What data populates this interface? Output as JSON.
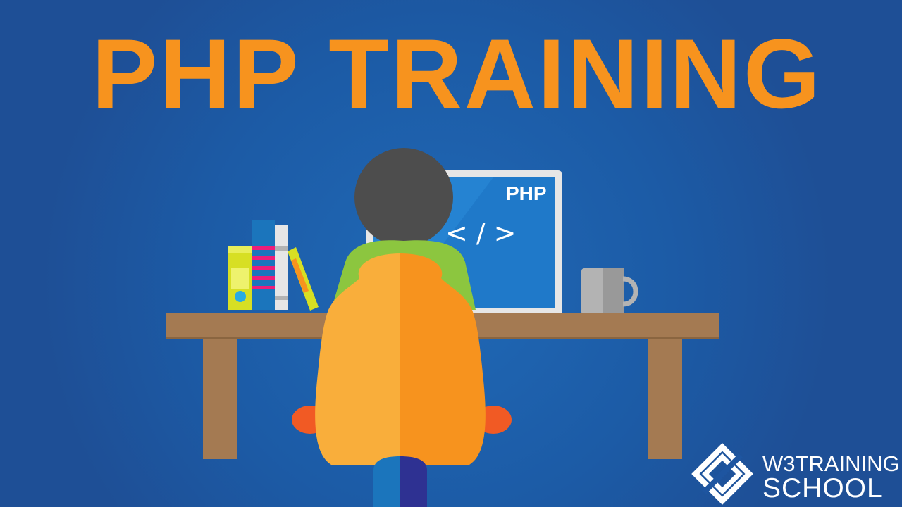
{
  "title": "PHP TRAINING",
  "laptop": {
    "screen_label": "PHP",
    "code_symbol": "</>"
  },
  "brand": {
    "line1": "W3TRAINING",
    "line2": "SCHOOL"
  },
  "colors": {
    "background": "#1e55a0",
    "title": "#f7931e",
    "desk": "#a47a52",
    "laptop_screen": "#1f79c9",
    "chair_left": "#f9ae3b",
    "chair_right": "#f7931e",
    "shirt": "#8cc63f",
    "head": "#4d4d4d"
  }
}
